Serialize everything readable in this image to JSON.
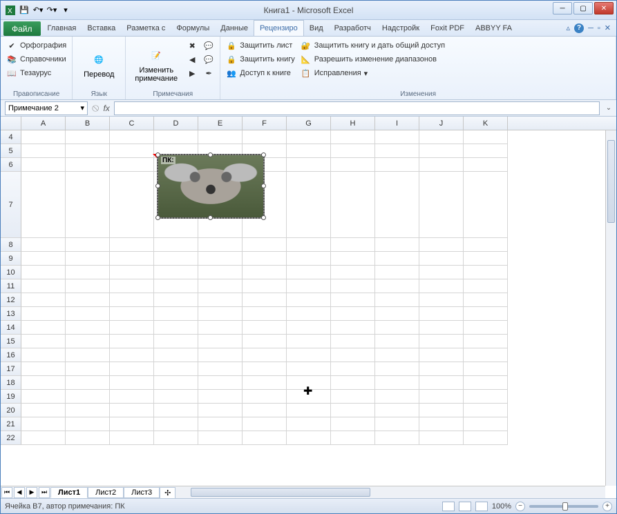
{
  "title": "Книга1 - Microsoft Excel",
  "qat": {
    "save": "💾",
    "undo": "↶",
    "redo": "↷"
  },
  "tabs": {
    "file": "Файл",
    "items": [
      "Главная",
      "Вставка",
      "Разметка с",
      "Формулы",
      "Данные",
      "Рецензиро",
      "Вид",
      "Разработч",
      "Надстройк",
      "Foxit PDF",
      "ABBYY FA"
    ],
    "active_index": 5
  },
  "ribbon": {
    "g1": {
      "label": "Правописание",
      "items": [
        "Орфография",
        "Справочники",
        "Тезаурус"
      ]
    },
    "g2": {
      "label": "Язык",
      "btn": "Перевод"
    },
    "g3": {
      "label": "Примечания",
      "btn": "Изменить примечание"
    },
    "g4": {
      "label": "Изменения",
      "col1": [
        "Защитить лист",
        "Защитить книгу",
        "Доступ к книге"
      ],
      "col2": [
        "Защитить книгу и дать общий доступ",
        "Разрешить изменение диапазонов",
        "Исправления"
      ]
    }
  },
  "namebox": "Примечание 2",
  "fx_label": "fx",
  "columns": [
    "A",
    "B",
    "C",
    "D",
    "E",
    "F",
    "G",
    "H",
    "I",
    "J",
    "K"
  ],
  "rows_start": 4,
  "rows_end": 22,
  "tall_row": 7,
  "comment": {
    "author": "ПК:"
  },
  "sheets": {
    "items": [
      "Лист1",
      "Лист2",
      "Лист3"
    ],
    "active": 0
  },
  "status": {
    "left": "Ячейка B7, автор примечания: ПК",
    "zoom": "100%"
  }
}
